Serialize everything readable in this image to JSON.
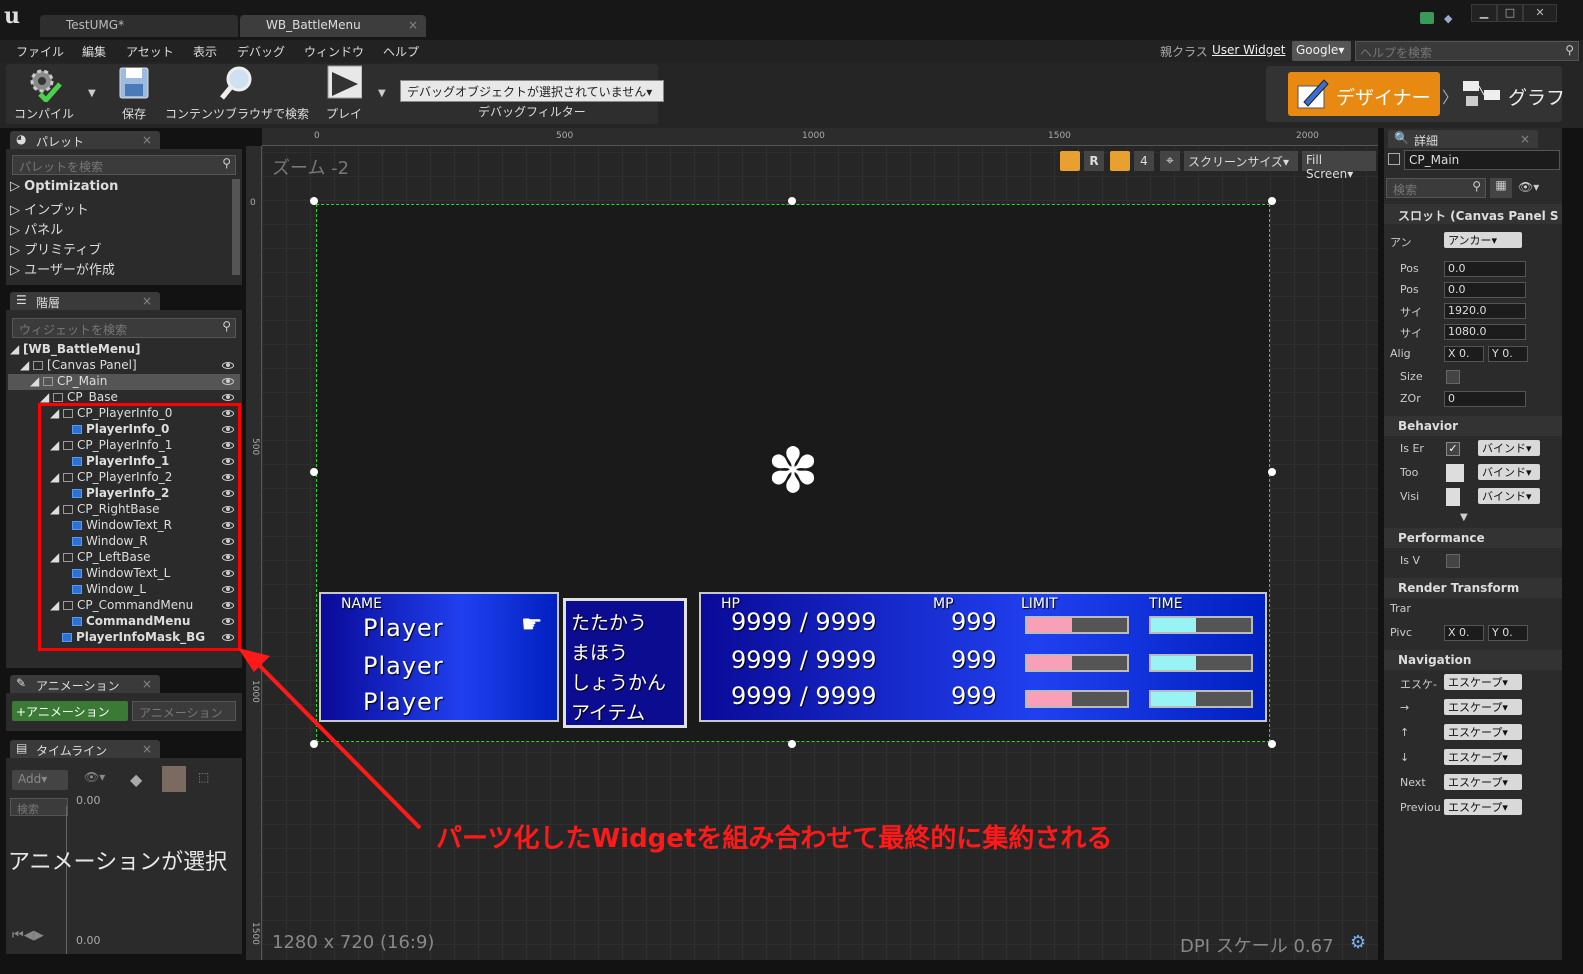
{
  "window": {
    "tabs": [
      {
        "label": "TestUMG*"
      },
      {
        "label": "WB_BattleMenu"
      }
    ]
  },
  "menubar": {
    "items": [
      "ファイル",
      "編集",
      "アセット",
      "表示",
      "デバッグ",
      "ウィンドウ",
      "ヘルプ"
    ],
    "parent_class_label": "親クラス",
    "parent_class_value": "User Widget",
    "search_engine": "Google▾",
    "help_search_placeholder": "ヘルプを検索"
  },
  "toolbar": {
    "compile": "コンパイル",
    "save": "保存",
    "browse": "コンテンツブラウザで検索",
    "play": "プレイ",
    "debug_object": "デバッグオブジェクトが選択されていません▾",
    "debug_filter": "デバッグフィルター",
    "designer": "デザイナー",
    "graph": "グラフ"
  },
  "palette": {
    "title": "パレット",
    "search_placeholder": "パレットを検索",
    "items": [
      "Optimization",
      "インプット",
      "パネル",
      "プリミティブ",
      "ユーザーが作成"
    ]
  },
  "hierarchy": {
    "title": "階層",
    "search_placeholder": "ウィジェットを検索",
    "items": [
      {
        "label": "[WB_BattleMenu]",
        "bold": true
      },
      {
        "label": "[Canvas Panel]"
      },
      {
        "label": "CP_Main"
      },
      {
        "label": "CP_Base"
      },
      {
        "label": "CP_PlayerInfo_0"
      },
      {
        "label": "PlayerInfo_0",
        "bold": true
      },
      {
        "label": "CP_PlayerInfo_1"
      },
      {
        "label": "PlayerInfo_1",
        "bold": true
      },
      {
        "label": "CP_PlayerInfo_2"
      },
      {
        "label": "PlayerInfo_2",
        "bold": true
      },
      {
        "label": "CP_RightBase"
      },
      {
        "label": "WindowText_R"
      },
      {
        "label": "Window_R"
      },
      {
        "label": "CP_LeftBase"
      },
      {
        "label": "WindowText_L"
      },
      {
        "label": "Window_L"
      },
      {
        "label": "CP_CommandMenu"
      },
      {
        "label": "CommandMenu",
        "bold": true
      },
      {
        "label": "PlayerInfoMask_BG",
        "bold": true
      }
    ]
  },
  "animation": {
    "title": "アニメーション",
    "add_button": "+アニメーション",
    "search_placeholder": "アニメーション"
  },
  "timeline": {
    "title": "タイムライン",
    "add_button": "Add▾",
    "search_placeholder": "検索",
    "time_top": "0.00",
    "time_bottom": "0.00",
    "empty_message": "アニメーションが選択"
  },
  "canvas": {
    "zoom": "ズーム -2",
    "resolution": "1280 x 720 (16:9)",
    "dpi": "DPI スケール 0.67",
    "ruler_top": [
      "0",
      "500",
      "1000",
      "1500",
      "2000"
    ],
    "ruler_left": [
      "0",
      "500",
      "1000",
      "1500"
    ],
    "toolbar": {
      "r": "R",
      "grid_num": "4",
      "screen_size": "スクリーンサイズ▾",
      "fill": "Fill Screen▾"
    }
  },
  "hud": {
    "header_name": "NAME",
    "header_hp": "HP",
    "header_mp": "MP",
    "header_limit": "LIMIT",
    "header_time": "TIME",
    "players": [
      {
        "name": "Player",
        "hp": "9999 / 9999",
        "mp": "999",
        "limit": 0.45,
        "time": 0.45
      },
      {
        "name": "Player",
        "hp": "9999 / 9999",
        "mp": "999",
        "limit": 0.45,
        "time": 0.45
      },
      {
        "name": "Player",
        "hp": "9999 / 9999",
        "mp": "999",
        "limit": 0.45,
        "time": 0.45
      }
    ],
    "commands": [
      "たたかう",
      "まほう",
      "しょうかん",
      "アイテム"
    ],
    "limit_color": "#f7a0b8",
    "time_color": "#98f4f4"
  },
  "details": {
    "title": "詳細",
    "name_value": "CP_Main",
    "search_placeholder": "検索",
    "slot_section": "スロット (Canvas Panel S",
    "anchor_label": "アン",
    "anchor_value": "アンカー▾",
    "rows": [
      {
        "label": "Pos",
        "value": "0.0"
      },
      {
        "label": "Pos",
        "value": "0.0"
      },
      {
        "label": "サイ",
        "value": "1920.0"
      },
      {
        "label": "サイ",
        "value": "1080.0"
      }
    ],
    "align_label": "Alig",
    "align_x": "X 0.",
    "align_y": "Y 0.",
    "size_label": "Size",
    "zorder_label": "ZOr",
    "zorder_value": "0",
    "behavior_section": "Behavior",
    "behavior_rows": [
      {
        "label": "Is Er",
        "bind": "バインド▾"
      },
      {
        "label": "Too",
        "bind": "バインド▾"
      },
      {
        "label": "Visi",
        "bind": "バインド▾"
      }
    ],
    "performance_section": "Performance",
    "perf_label": "Is V",
    "render_section": "Render Transform",
    "render_rows": [
      {
        "label": "Trar"
      },
      {
        "label": "Pivc",
        "x": "X 0.",
        "y": "Y 0."
      }
    ],
    "navigation_section": "Navigation",
    "nav_rows": [
      {
        "label": "エスケ-",
        "value": "エスケープ▾"
      },
      {
        "label": "→",
        "value": "エスケープ▾"
      },
      {
        "label": "↑",
        "value": "エスケープ▾"
      },
      {
        "label": "↓",
        "value": "エスケープ▾"
      },
      {
        "label": "Next",
        "value": "エスケープ▾"
      },
      {
        "label": "Previou",
        "value": "エスケープ▾"
      }
    ]
  },
  "annotation": {
    "text": "パーツ化したWidgetを組み合わせて最終的に集約される",
    "color": "#ff1a1a"
  }
}
